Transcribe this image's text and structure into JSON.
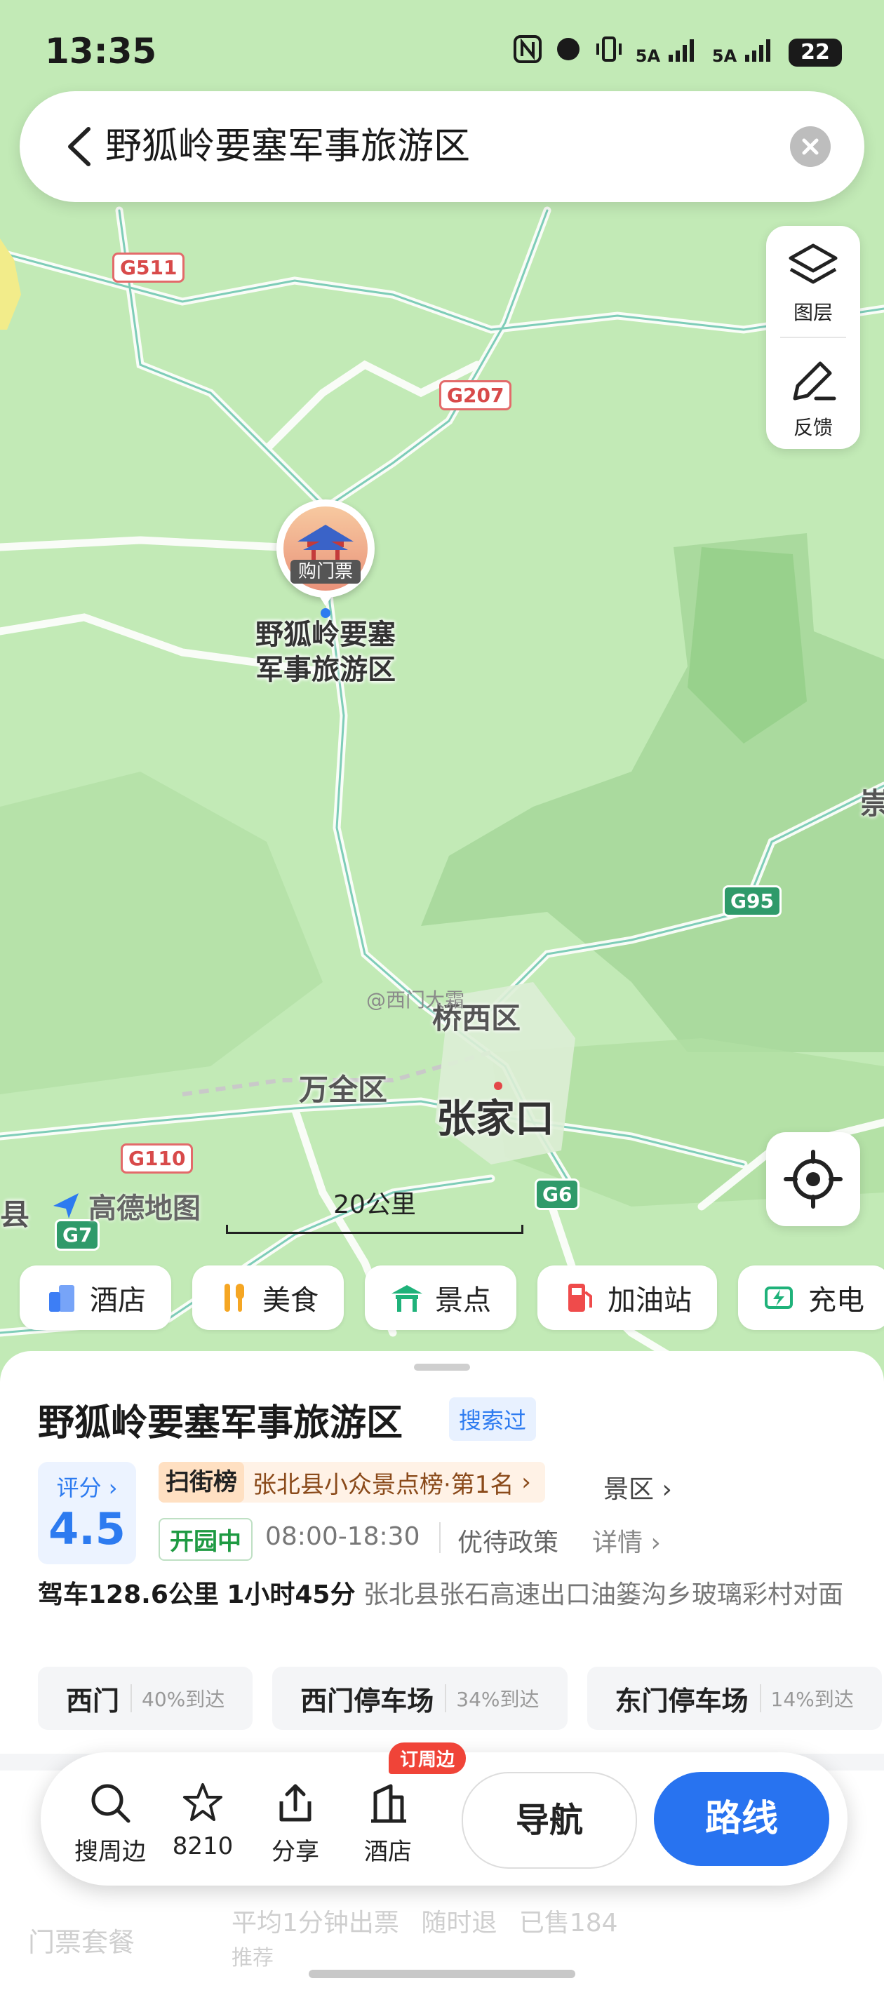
{
  "status_bar": {
    "time": "13:35",
    "net1": "5A",
    "net2": "5A",
    "battery": "22"
  },
  "search": {
    "query": "野狐岭要塞军事旅游区"
  },
  "tools": {
    "layers_label": "图层",
    "feedback_label": "反馈"
  },
  "map": {
    "roads": {
      "g511": "G511",
      "g207": "G207",
      "g95": "G95",
      "g110": "G110",
      "g6": "G6",
      "g7": "G7"
    },
    "poi": {
      "ticket_tag": "购门票",
      "name_line1": "野狐岭要塞",
      "name_line2": "军事旅游区"
    },
    "places": {
      "qiaoxi": "桥西区",
      "wanquan": "万全区",
      "zhangjiakou": "张家口",
      "edge_right": "崇",
      "edge_left": "县"
    },
    "logo": "高德地图",
    "scale": "20公里",
    "watermark": "@西门大霜"
  },
  "categories": [
    {
      "label": "酒店",
      "icon": "building-icon",
      "color": "#3d7ef5"
    },
    {
      "label": "美食",
      "icon": "food-icon",
      "color": "#f5a623"
    },
    {
      "label": "景点",
      "icon": "pavilion-icon",
      "color": "#1fb27a"
    },
    {
      "label": "加油站",
      "icon": "gas-icon",
      "color": "#ef4b4b"
    },
    {
      "label": "充电",
      "icon": "charge-icon",
      "color": "#1fb27a"
    }
  ],
  "place": {
    "title": "野狐岭要塞军事旅游区",
    "searched_tag": "搜索过",
    "score_label": "评分",
    "score_value": "4.5",
    "rank_badge": "扫街榜",
    "rank_text": "张北县小众景点榜·第1名",
    "category": "景区",
    "open_status": "开园中",
    "hours": "08:00-18:30",
    "policy": "优待政策",
    "detail": "详情",
    "drive_distance": "驾车128.6公里",
    "drive_time": "1小时45分",
    "address": "张北县张石高速出口油篓沟乡玻璃彩村对面",
    "parking": [
      {
        "name": "西门",
        "pct": "40%到达"
      },
      {
        "name": "西门停车场",
        "pct": "34%到达"
      },
      {
        "name": "东门停车场",
        "pct": "14%到达"
      }
    ],
    "ticket_label": "门票套餐",
    "ticket_info": "平均1分钟出票",
    "refund": "随时退",
    "sold": "已售184",
    "recommend": "推荐"
  },
  "actions": {
    "nearby": "搜周边",
    "favorites": "8210",
    "share": "分享",
    "hotel": "酒店",
    "hotel_badge": "订周边",
    "navigate": "导航",
    "route": "路线"
  }
}
